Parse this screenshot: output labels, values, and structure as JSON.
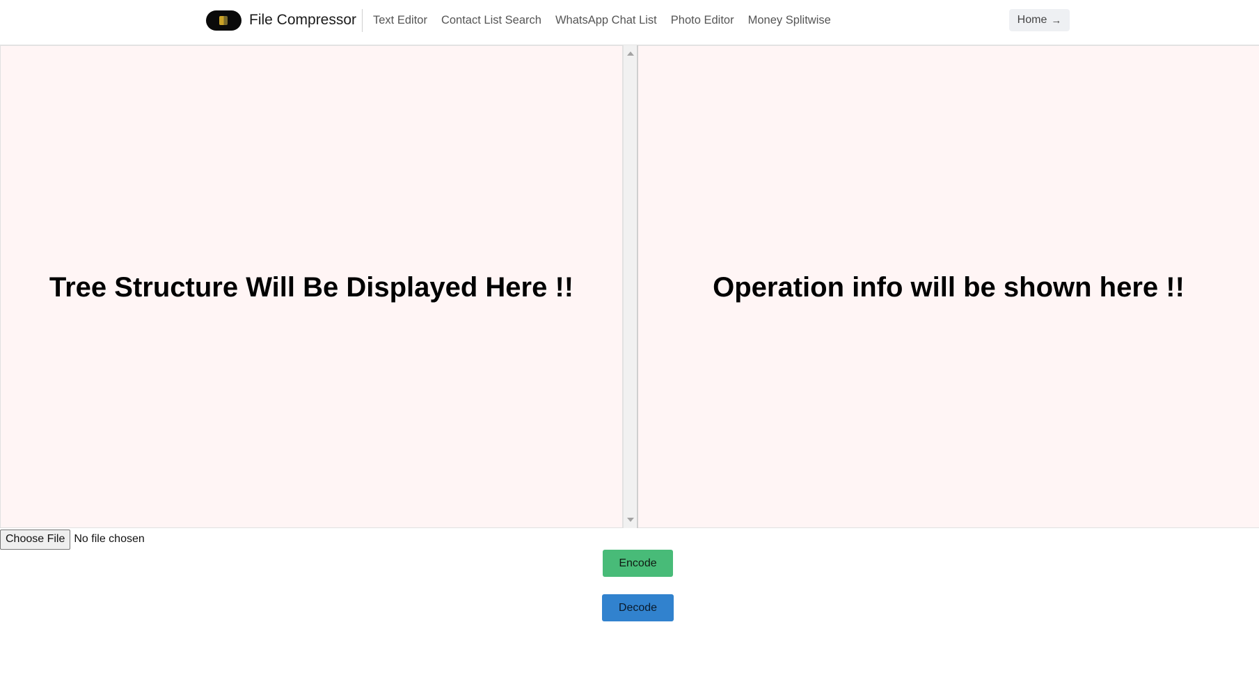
{
  "header": {
    "brand": "File Compressor",
    "nav": [
      "Text Editor",
      "Contact List Search",
      "WhatsApp Chat List",
      "Photo Editor",
      "Money Splitwise"
    ],
    "home_label": "Home",
    "home_icon": "arrow-right-icon"
  },
  "panels": {
    "left_message": "Tree Structure Will Be Displayed Here !!",
    "right_message": "Operation info will be shown here !!"
  },
  "file_input": {
    "button_label": "Choose File",
    "status": "No file chosen"
  },
  "actions": {
    "encode_label": "Encode",
    "decode_label": "Decode"
  },
  "colors": {
    "panel_bg": "#fff5f5",
    "encode": "#48bb78",
    "decode": "#3182ce"
  }
}
